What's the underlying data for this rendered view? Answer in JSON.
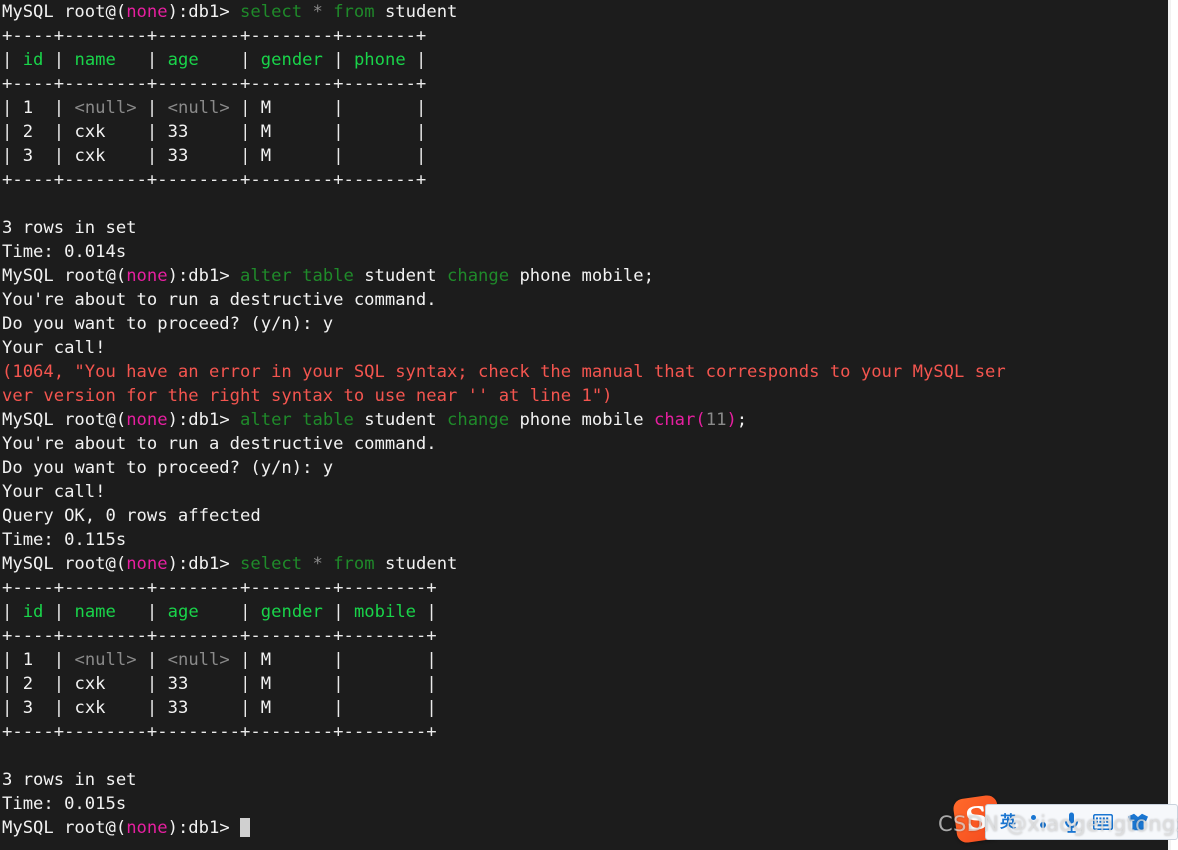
{
  "terminal": {
    "background_color": "#1c1c1c",
    "foreground_color": "#f2f2f2",
    "prompt": {
      "prefix": "MySQL root@(",
      "db_none": "none",
      "suffix": "):db1> "
    },
    "colors": {
      "keyword_green": "#1f8a2a",
      "header_green": "#19d44a",
      "magenta": "#e61fa0",
      "gray": "#8a8a8a",
      "error_red": "#f4554f",
      "border": "#eaeaea"
    },
    "lines": [
      {
        "id": "l01",
        "type": "prompt",
        "command_tokens": [
          {
            "t": "select",
            "c": "grn"
          },
          {
            "t": " ",
            "c": "w"
          },
          {
            "t": "*",
            "c": "gry"
          },
          {
            "t": " ",
            "c": "w"
          },
          {
            "t": "from",
            "c": "grn"
          },
          {
            "t": " student",
            "c": "w"
          }
        ]
      },
      {
        "id": "l02",
        "type": "border",
        "text": "+----+--------+--------+--------+-------+"
      },
      {
        "id": "l03",
        "type": "header",
        "cells": [
          "id",
          "name",
          "age",
          "gender",
          "phone"
        ]
      },
      {
        "id": "l04",
        "type": "border",
        "text": "+----+--------+--------+--------+-------+"
      },
      {
        "id": "l05",
        "type": "row",
        "cells": [
          "1",
          "<null>",
          "<null>",
          "M",
          ""
        ],
        "null_cells": [
          1,
          2
        ]
      },
      {
        "id": "l06",
        "type": "row",
        "cells": [
          "2",
          "cxk",
          "33",
          "M",
          ""
        ],
        "null_cells": []
      },
      {
        "id": "l07",
        "type": "row",
        "cells": [
          "3",
          "cxk",
          "33",
          "M",
          ""
        ],
        "null_cells": []
      },
      {
        "id": "l08",
        "type": "border",
        "text": "+----+--------+--------+--------+-------+"
      },
      {
        "id": "l09",
        "type": "blank",
        "text": ""
      },
      {
        "id": "l10",
        "type": "plain",
        "text": "3 rows in set"
      },
      {
        "id": "l11",
        "type": "plain",
        "text": "Time: 0.014s"
      },
      {
        "id": "l12",
        "type": "prompt",
        "command_tokens": [
          {
            "t": "alter table",
            "c": "grn"
          },
          {
            "t": " student ",
            "c": "w"
          },
          {
            "t": "change",
            "c": "grn"
          },
          {
            "t": " phone mobile;",
            "c": "w"
          }
        ]
      },
      {
        "id": "l13",
        "type": "plain",
        "text": "You're about to run a destructive command."
      },
      {
        "id": "l14",
        "type": "plain",
        "text": "Do you want to proceed? (y/n): y"
      },
      {
        "id": "l15",
        "type": "plain",
        "text": "Your call!"
      },
      {
        "id": "l16",
        "type": "error",
        "text": "(1064, \"You have an error in your SQL syntax; check the manual that corresponds to your MySQL ser"
      },
      {
        "id": "l17",
        "type": "error",
        "text": "ver version for the right syntax to use near '' at line 1\")"
      },
      {
        "id": "l18",
        "type": "prompt",
        "command_tokens": [
          {
            "t": "alter table",
            "c": "grn"
          },
          {
            "t": " student ",
            "c": "w"
          },
          {
            "t": "change",
            "c": "grn"
          },
          {
            "t": " phone mobile ",
            "c": "w"
          },
          {
            "t": "char",
            "c": "mag"
          },
          {
            "t": "(",
            "c": "mag"
          },
          {
            "t": "11",
            "c": "gry"
          },
          {
            "t": ")",
            "c": "mag"
          },
          {
            "t": ";",
            "c": "w"
          }
        ]
      },
      {
        "id": "l19",
        "type": "plain",
        "text": "You're about to run a destructive command."
      },
      {
        "id": "l20",
        "type": "plain",
        "text": "Do you want to proceed? (y/n): y"
      },
      {
        "id": "l21",
        "type": "plain",
        "text": "Your call!"
      },
      {
        "id": "l22",
        "type": "plain",
        "text": "Query OK, 0 rows affected"
      },
      {
        "id": "l23",
        "type": "plain",
        "text": "Time: 0.115s"
      },
      {
        "id": "l24",
        "type": "prompt",
        "command_tokens": [
          {
            "t": "select",
            "c": "grn"
          },
          {
            "t": " ",
            "c": "w"
          },
          {
            "t": "*",
            "c": "gry"
          },
          {
            "t": " ",
            "c": "w"
          },
          {
            "t": "from",
            "c": "grn"
          },
          {
            "t": " student",
            "c": "w"
          }
        ]
      },
      {
        "id": "l25",
        "type": "border",
        "text": "+----+--------+--------+--------+--------+"
      },
      {
        "id": "l26",
        "type": "header",
        "cells": [
          "id",
          "name",
          "age",
          "gender",
          "mobile"
        ]
      },
      {
        "id": "l27",
        "type": "border",
        "text": "+----+--------+--------+--------+--------+"
      },
      {
        "id": "l28",
        "type": "row",
        "cells": [
          "1",
          "<null>",
          "<null>",
          "M",
          ""
        ],
        "null_cells": [
          1,
          2
        ]
      },
      {
        "id": "l29",
        "type": "row",
        "cells": [
          "2",
          "cxk",
          "33",
          "M",
          ""
        ],
        "null_cells": []
      },
      {
        "id": "l30",
        "type": "row",
        "cells": [
          "3",
          "cxk",
          "33",
          "M",
          ""
        ],
        "null_cells": []
      },
      {
        "id": "l31",
        "type": "border",
        "text": "+----+--------+--------+--------+--------+"
      },
      {
        "id": "l32",
        "type": "blank",
        "text": ""
      },
      {
        "id": "l33",
        "type": "plain",
        "text": "3 rows in set"
      },
      {
        "id": "l34",
        "type": "plain",
        "text": "Time: 0.015s"
      },
      {
        "id": "l35",
        "type": "cursor_prompt",
        "command_tokens": []
      }
    ]
  },
  "ime_toolbar": {
    "logo_label": "S",
    "items": [
      {
        "name": "english-mode",
        "label": "英",
        "kind": "text"
      },
      {
        "name": "punctuation-mode",
        "label": "",
        "kind": "dots"
      },
      {
        "name": "voice-input",
        "label": "",
        "kind": "mic"
      },
      {
        "name": "soft-keyboard",
        "label": "",
        "kind": "keyboard"
      },
      {
        "name": "skin-theme",
        "label": "",
        "kind": "shirt"
      }
    ]
  },
  "watermark": {
    "text": "CSDN @xiaogengtongxue"
  }
}
